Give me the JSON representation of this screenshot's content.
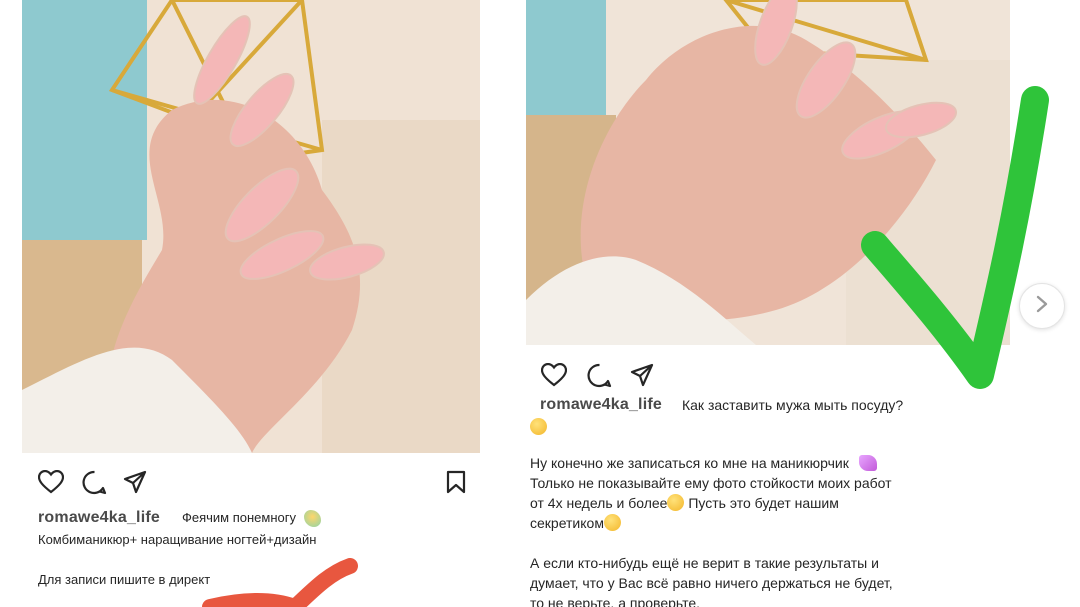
{
  "post_left": {
    "username": "romawe4ka_life",
    "caption_line1": "Феячим понемногу",
    "caption_line2": "Комбиманикюр+ наращивание ногтей+дизайн",
    "caption_line3": "Для записи пишите в директ",
    "icons": [
      "heart-icon",
      "comment-icon",
      "share-icon",
      "bookmark-icon",
      "fairy-emoji"
    ]
  },
  "post_right": {
    "username": "romawe4ka_life",
    "caption_title": "Как заставить мужа мыть посуду?",
    "para1_line1": "Ну конечно же записаться ко мне на маникюрчик",
    "para1_line2": "Только не показывайте ему фото стойкости моих работ",
    "para1_line3a": "от 4х недель и более",
    "para1_line3b": "Пусть это будет нашим",
    "para1_line4": "секретиком",
    "para2_line1": "А если кто-нибудь ещё не верит в такие результаты и",
    "para2_line2": "думает, что у Вас всё равно ничего держаться не будет,",
    "para2_line3": "то не верьте, а проверьте.",
    "icons": [
      "heart-icon",
      "comment-icon",
      "share-icon",
      "nail-polish-emoji",
      "smirk-emoji"
    ]
  },
  "carousel": {
    "next_icon": "chevron-right-icon"
  },
  "annotations": {
    "left_mark_color": "#e8573f",
    "right_check_color": "#2fc43a"
  }
}
